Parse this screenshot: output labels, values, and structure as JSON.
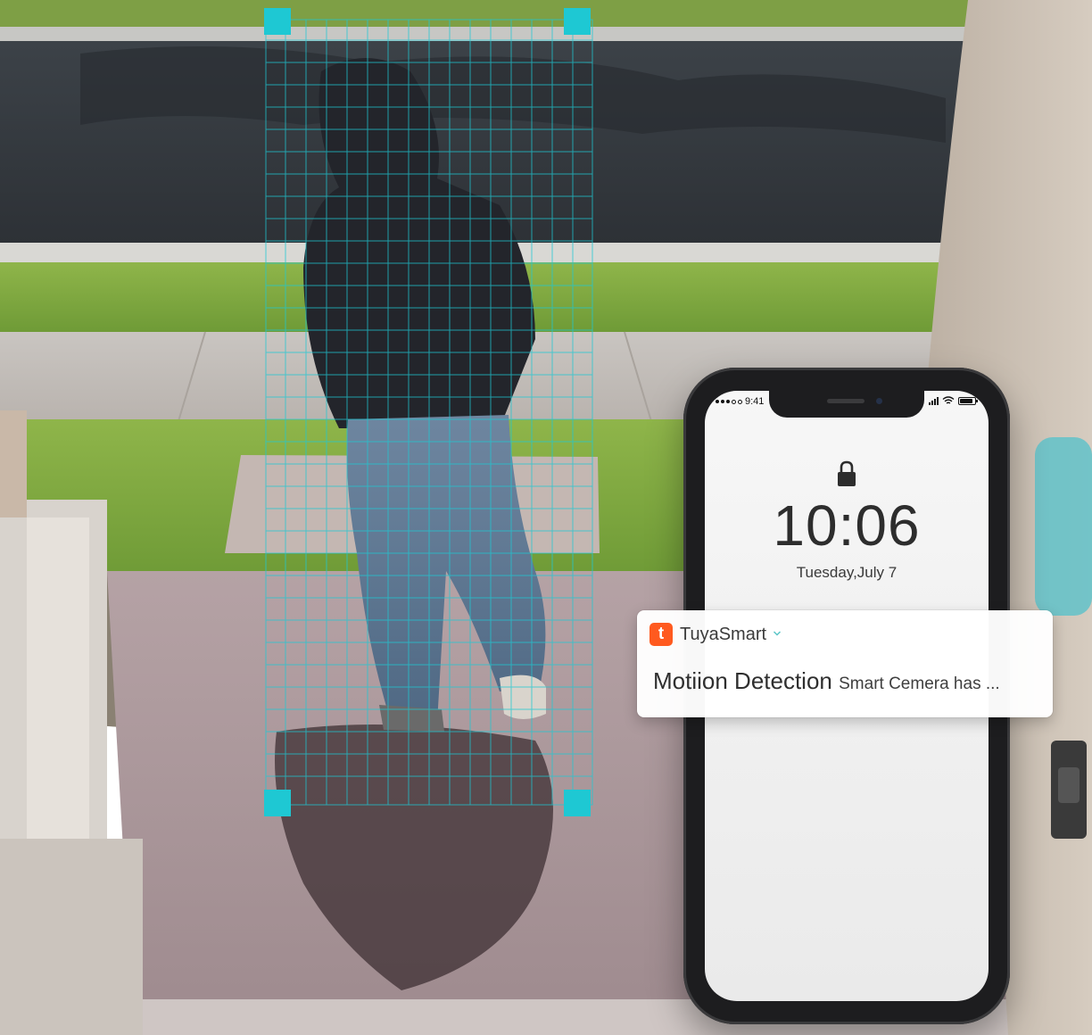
{
  "phone": {
    "status_time": "9:41",
    "lock_time": "10:06",
    "lock_date": "Tuesday,July 7"
  },
  "notification": {
    "app_icon_letter": "t",
    "app_name": "TuyaSmart",
    "title": "Motiion Detection",
    "body": "Smart Cemera has ..."
  },
  "detection_overlay": {
    "color": "#1ec8d3"
  },
  "colors": {
    "brand_orange": "#ff5a1f",
    "grid_cyan": "#1ec8d3"
  }
}
